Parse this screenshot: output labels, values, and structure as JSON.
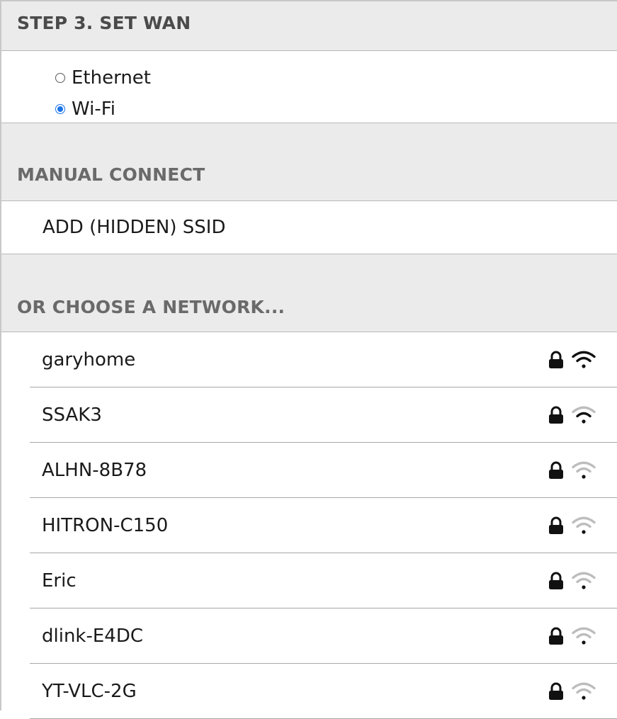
{
  "step_header": {
    "title": "STEP 3. SET WAN"
  },
  "wan_options": [
    {
      "label": "Ethernet",
      "checked": false
    },
    {
      "label": "Wi-Fi",
      "checked": true
    }
  ],
  "manual_connect": {
    "header": "MANUAL CONNECT",
    "add_ssid_label": "ADD (HIDDEN) SSID"
  },
  "network_section": {
    "header": "OR CHOOSE A NETWORK...",
    "networks": [
      {
        "ssid": "garyhome",
        "secured": true,
        "signal_bars": 3,
        "icons": [
          "lock-icon",
          "wifi-signal-icon"
        ]
      },
      {
        "ssid": "SSAK3",
        "secured": true,
        "signal_bars": 2,
        "icons": [
          "lock-icon",
          "wifi-signal-icon"
        ]
      },
      {
        "ssid": "ALHN-8B78",
        "secured": true,
        "signal_bars": 1,
        "icons": [
          "lock-icon",
          "wifi-signal-icon"
        ]
      },
      {
        "ssid": "HITRON-C150",
        "secured": true,
        "signal_bars": 1,
        "icons": [
          "lock-icon",
          "wifi-signal-icon"
        ]
      },
      {
        "ssid": "Eric",
        "secured": true,
        "signal_bars": 1,
        "icons": [
          "lock-icon",
          "wifi-signal-icon"
        ]
      },
      {
        "ssid": "dlink-E4DC",
        "secured": true,
        "signal_bars": 1,
        "icons": [
          "lock-icon",
          "wifi-signal-icon"
        ]
      },
      {
        "ssid": "YT-VLC-2G",
        "secured": true,
        "signal_bars": 1,
        "icons": [
          "lock-icon",
          "wifi-signal-icon"
        ]
      }
    ]
  },
  "colors": {
    "header_bg": "#ebebeb",
    "radio_accent": "#1a73e8",
    "signal_active": "#111111",
    "signal_inactive": "#bdbdbd"
  }
}
